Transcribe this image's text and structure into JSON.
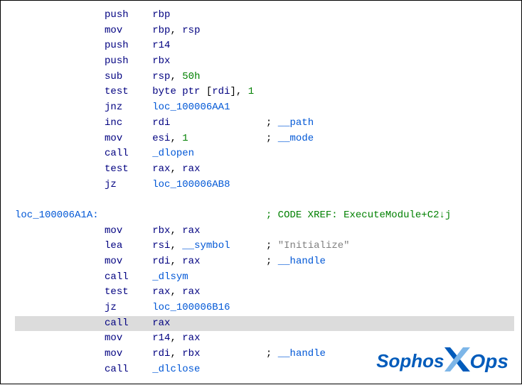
{
  "branding": {
    "left": "Sophos",
    "right": "Ops"
  },
  "asm": {
    "indent": "               ",
    "label_indent": "",
    "lines": [
      {
        "mnemonic": "push",
        "ops": [
          {
            "t": "reg",
            "v": "rbp"
          }
        ]
      },
      {
        "mnemonic": "mov",
        "ops": [
          {
            "t": "reg",
            "v": "rbp"
          },
          {
            "t": "sep",
            "v": ", "
          },
          {
            "t": "reg",
            "v": "rsp"
          }
        ]
      },
      {
        "mnemonic": "push",
        "ops": [
          {
            "t": "reg",
            "v": "r14"
          }
        ]
      },
      {
        "mnemonic": "push",
        "ops": [
          {
            "t": "reg",
            "v": "rbx"
          }
        ]
      },
      {
        "mnemonic": "sub",
        "ops": [
          {
            "t": "reg",
            "v": "rsp"
          },
          {
            "t": "sep",
            "v": ", "
          },
          {
            "t": "num",
            "v": "50h"
          }
        ]
      },
      {
        "mnemonic": "test",
        "ops": [
          {
            "t": "keyword",
            "v": "byte ptr "
          },
          {
            "t": "text",
            "v": "["
          },
          {
            "t": "reg",
            "v": "rdi"
          },
          {
            "t": "text",
            "v": "], "
          },
          {
            "t": "num",
            "v": "1"
          }
        ]
      },
      {
        "mnemonic": "jnz",
        "ops": [
          {
            "t": "name",
            "v": "loc_100006AA1"
          }
        ]
      },
      {
        "mnemonic": "inc",
        "ops": [
          {
            "t": "reg",
            "v": "rdi"
          }
        ],
        "comment": "__path",
        "comment_type": "idfr"
      },
      {
        "mnemonic": "mov",
        "ops": [
          {
            "t": "reg",
            "v": "esi"
          },
          {
            "t": "sep",
            "v": ", "
          },
          {
            "t": "num",
            "v": "1"
          }
        ],
        "comment": "__mode",
        "comment_type": "idfr"
      },
      {
        "mnemonic": "call",
        "ops": [
          {
            "t": "name",
            "v": "_dlopen"
          }
        ]
      },
      {
        "mnemonic": "test",
        "ops": [
          {
            "t": "reg",
            "v": "rax"
          },
          {
            "t": "sep",
            "v": ", "
          },
          {
            "t": "reg",
            "v": "rax"
          }
        ]
      },
      {
        "mnemonic": "jz",
        "ops": [
          {
            "t": "name",
            "v": "loc_100006AB8"
          }
        ]
      },
      {
        "blank": true
      },
      {
        "label": "loc_100006A1A:",
        "xref": "CODE XREF: ExecuteModule+C2↓j"
      },
      {
        "mnemonic": "mov",
        "ops": [
          {
            "t": "reg",
            "v": "rbx"
          },
          {
            "t": "sep",
            "v": ", "
          },
          {
            "t": "reg",
            "v": "rax"
          }
        ]
      },
      {
        "mnemonic": "lea",
        "ops": [
          {
            "t": "reg",
            "v": "rsi"
          },
          {
            "t": "sep",
            "v": ", "
          },
          {
            "t": "name",
            "v": "__symbol"
          }
        ],
        "comment": "\"Initialize\"",
        "comment_type": "str"
      },
      {
        "mnemonic": "mov",
        "ops": [
          {
            "t": "reg",
            "v": "rdi"
          },
          {
            "t": "sep",
            "v": ", "
          },
          {
            "t": "reg",
            "v": "rax"
          }
        ],
        "comment": "__handle",
        "comment_type": "idfr"
      },
      {
        "mnemonic": "call",
        "ops": [
          {
            "t": "name",
            "v": "_dlsym"
          }
        ]
      },
      {
        "mnemonic": "test",
        "ops": [
          {
            "t": "reg",
            "v": "rax"
          },
          {
            "t": "sep",
            "v": ", "
          },
          {
            "t": "reg",
            "v": "rax"
          }
        ]
      },
      {
        "mnemonic": "jz",
        "ops": [
          {
            "t": "name",
            "v": "loc_100006B16"
          }
        ]
      },
      {
        "mnemonic": "call",
        "ops": [
          {
            "t": "reg",
            "v": "rax"
          }
        ],
        "highlight": true
      },
      {
        "mnemonic": "mov",
        "ops": [
          {
            "t": "reg",
            "v": "r14"
          },
          {
            "t": "sep",
            "v": ", "
          },
          {
            "t": "reg",
            "v": "rax"
          }
        ]
      },
      {
        "mnemonic": "mov",
        "ops": [
          {
            "t": "reg",
            "v": "rdi"
          },
          {
            "t": "sep",
            "v": ", "
          },
          {
            "t": "reg",
            "v": "rbx"
          }
        ],
        "comment": "__handle",
        "comment_type": "idfr"
      },
      {
        "mnemonic": "call",
        "ops": [
          {
            "t": "name",
            "v": "_dlclose"
          }
        ]
      }
    ]
  }
}
